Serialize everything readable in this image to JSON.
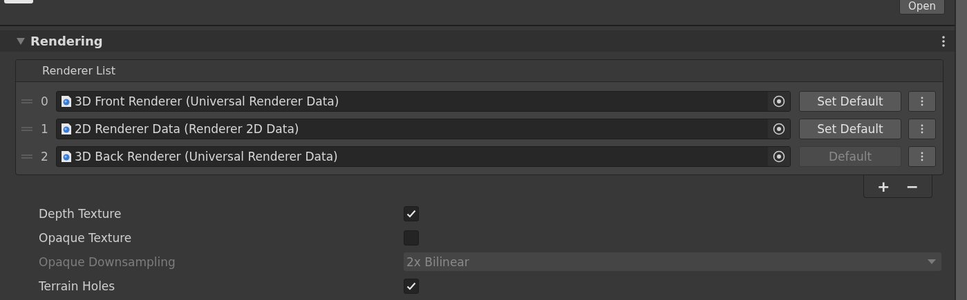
{
  "top_bar": {
    "button": "Open"
  },
  "section": {
    "title": "Rendering",
    "expanded": true,
    "renderer_list": {
      "title": "Renderer List",
      "items": [
        {
          "index": "0",
          "name": "3D Front Renderer (Universal Renderer Data)",
          "action": "Set Default",
          "is_default": false
        },
        {
          "index": "1",
          "name": "2D Renderer Data (Renderer 2D Data)",
          "action": "Set Default",
          "is_default": false
        },
        {
          "index": "2",
          "name": "3D Back Renderer (Universal Renderer Data)",
          "action": "Default",
          "is_default": true
        }
      ],
      "footer": {
        "add": "+",
        "remove": "−"
      }
    },
    "properties": [
      {
        "kind": "checkbox",
        "label": "Depth Texture",
        "checked": true,
        "disabled": false
      },
      {
        "kind": "checkbox",
        "label": "Opaque Texture",
        "checked": false,
        "disabled": false
      },
      {
        "kind": "dropdown",
        "label": "Opaque Downsampling",
        "value": "2x Bilinear",
        "disabled": true
      },
      {
        "kind": "checkbox",
        "label": "Terrain Holes",
        "checked": true,
        "disabled": false
      }
    ]
  }
}
